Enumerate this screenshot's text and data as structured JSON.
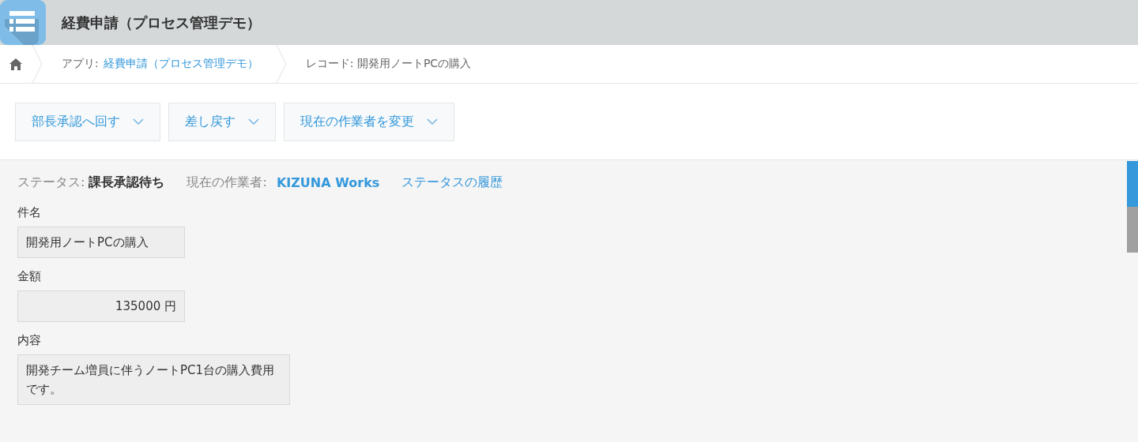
{
  "header": {
    "title": "経費申請（プロセス管理デモ）"
  },
  "breadcrumb": [
    {
      "kind": "home"
    },
    {
      "kind": "app",
      "label": "アプリ:",
      "link": "経費申請（プロセス管理デモ）"
    },
    {
      "kind": "record",
      "label": "レコード: 開発用ノートPCの購入"
    }
  ],
  "actions": [
    {
      "label": "部長承認へ回す"
    },
    {
      "label": "差し戻す"
    },
    {
      "label": "現在の作業者を変更"
    }
  ],
  "status": {
    "label": "ステータス:",
    "value": "課長承認待ち",
    "assignee_label": "現在の作業者:",
    "assignee": "KIZUNA Works",
    "history_link": "ステータスの履歴"
  },
  "fields": [
    {
      "kind": "text",
      "label": "件名",
      "value": "開発用ノートPCの購入"
    },
    {
      "kind": "number",
      "label": "金額",
      "value": "135000 円"
    },
    {
      "kind": "multiline",
      "label": "内容",
      "value": "開発チーム増員に伴うノートPC1台の購入費用です。"
    }
  ],
  "side_tabs": [
    {
      "selected": true
    },
    {
      "selected": false
    }
  ]
}
